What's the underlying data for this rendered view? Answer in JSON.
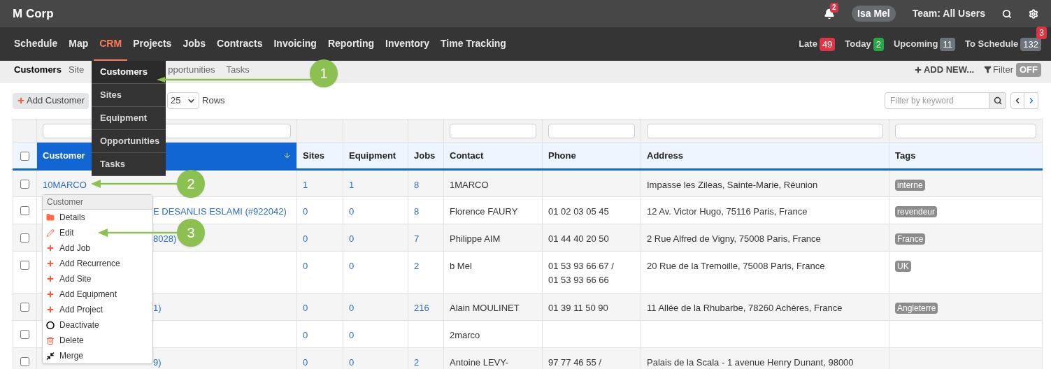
{
  "brand": "M Corp",
  "topbar": {
    "notifications": "2",
    "user": "Isa Mel",
    "team": "Team: All Users"
  },
  "nav": [
    {
      "label": "Schedule",
      "selected": false
    },
    {
      "label": "Map",
      "selected": false
    },
    {
      "label": "CRM",
      "selected": true
    },
    {
      "label": "Projects",
      "selected": false
    },
    {
      "label": "Jobs",
      "selected": false
    },
    {
      "label": "Contracts",
      "selected": false
    },
    {
      "label": "Invoicing",
      "selected": false
    },
    {
      "label": "Reporting",
      "selected": false
    },
    {
      "label": "Inventory",
      "selected": false
    },
    {
      "label": "Time Tracking",
      "selected": false
    }
  ],
  "counters": [
    {
      "label": "Late",
      "count": "49",
      "color": "#dc3545"
    },
    {
      "label": "Today",
      "count": "2",
      "color": "#28a745"
    },
    {
      "label": "Upcoming",
      "count": "11",
      "color": "#6c757d"
    },
    {
      "label": "To Schedule",
      "count": "132",
      "color": "#6c757d"
    }
  ],
  "counters_alert": "3",
  "subnav": [
    {
      "label": "Customers",
      "selected": true
    },
    {
      "label": "Site",
      "selected": false
    },
    {
      "label": "pportunities",
      "selected": false
    },
    {
      "label": "Tasks",
      "selected": false
    }
  ],
  "add_new": "ADD NEW...",
  "filter": {
    "label": "Filter",
    "on": false,
    "off_label": "OFF"
  },
  "crm_menu": [
    {
      "label": "Customers",
      "selected": true
    },
    {
      "label": "Sites",
      "selected": false
    },
    {
      "label": "Equipment",
      "selected": false
    },
    {
      "label": "Opportunities",
      "selected": false
    },
    {
      "label": "Tasks",
      "selected": false
    }
  ],
  "toolbar": {
    "add_button": "Add Customer",
    "page_size": "25",
    "rows_label": "Rows",
    "search_placeholder": "Filter by keyword"
  },
  "table": {
    "columns": [
      {
        "label": "Customer",
        "sorted": true,
        "filter": true
      },
      {
        "label": "Sites",
        "sorted": false,
        "filter": false
      },
      {
        "label": "Equipment",
        "sorted": false,
        "filter": false
      },
      {
        "label": "Jobs",
        "sorted": false,
        "filter": false
      },
      {
        "label": "Contact",
        "sorted": false,
        "filter": true
      },
      {
        "label": "Phone",
        "sorted": false,
        "filter": true
      },
      {
        "label": "Address",
        "sorted": false,
        "filter": true
      },
      {
        "label": "Tags",
        "sorted": false,
        "filter": true
      }
    ],
    "header_checked": false,
    "rows": [
      {
        "checked": false,
        "customer": "10MARCO",
        "sites": "1",
        "equipment": "1",
        "jobs": "8",
        "contact": "1MARCO",
        "phone": [],
        "address": "Impasse les Zileas, Sainte-Marie, Réunion",
        "tag": "interne"
      },
      {
        "checked": false,
        "customer": "E DESANLIS ESLAMI (#922042)",
        "sites": "0",
        "equipment": "0",
        "jobs": "8",
        "contact": "Florence FAURY",
        "phone": [
          "01 02 03 05 45"
        ],
        "address": "12 Av. Victor Hugo, 75116 Paris, France",
        "tag": "revendeur"
      },
      {
        "checked": false,
        "customer": "8028)",
        "sites": "0",
        "equipment": "0",
        "jobs": "7",
        "contact": "Philippe AIM",
        "phone": [
          "01 44 40 20 50"
        ],
        "address": "2 Rue Alfred de Vigny, 75008 Paris, France",
        "tag": "France"
      },
      {
        "checked": false,
        "sites": "0",
        "equipment": "0",
        "jobs": "2",
        "contact": "b Mel",
        "phone": [
          "01 53 93 66 67 /",
          "01 53 93 66 66"
        ],
        "address": "20 Rue de la Tremoille, 75008 Paris, France",
        "tag": "UK"
      },
      {
        "checked": false,
        "customer": "1)",
        "sites": "0",
        "equipment": "0",
        "jobs": "216",
        "contact": "Alain MOULINET",
        "phone": [
          "01 39 11 50 90"
        ],
        "address": "11 Allée de la Rhubarbe, 78260 Achères, France",
        "tag": "Angleterre"
      },
      {
        "checked": false,
        "sites": "0",
        "equipment": "0",
        "contact": "2marco",
        "phone": []
      },
      {
        "checked": false,
        "customer": "9)",
        "sites": "0",
        "equipment": "0",
        "jobs": "2",
        "contact": "Antoine LEVY-",
        "phone": [
          "97 77 46 55 /"
        ],
        "address": "Palais de la Scala - 1 avenue Henry Dunant, 98000"
      }
    ]
  },
  "context_menu": {
    "title": "Customer",
    "items": [
      {
        "kind": "folder",
        "label": "Details"
      },
      {
        "kind": "edit",
        "label": "Edit"
      },
      {
        "kind": "add",
        "label": "Add Job"
      },
      {
        "kind": "add",
        "label": "Add Recurrence"
      },
      {
        "kind": "add",
        "label": "Add Site"
      },
      {
        "kind": "add",
        "label": "Add Equipment"
      },
      {
        "kind": "add",
        "label": "Add Project"
      },
      {
        "kind": "deactivate",
        "label": "Deactivate"
      },
      {
        "kind": "delete",
        "label": "Delete"
      },
      {
        "kind": "merge",
        "label": "Merge"
      }
    ]
  },
  "callouts": [
    {
      "number": "1"
    },
    {
      "number": "2"
    },
    {
      "number": "3"
    }
  ]
}
